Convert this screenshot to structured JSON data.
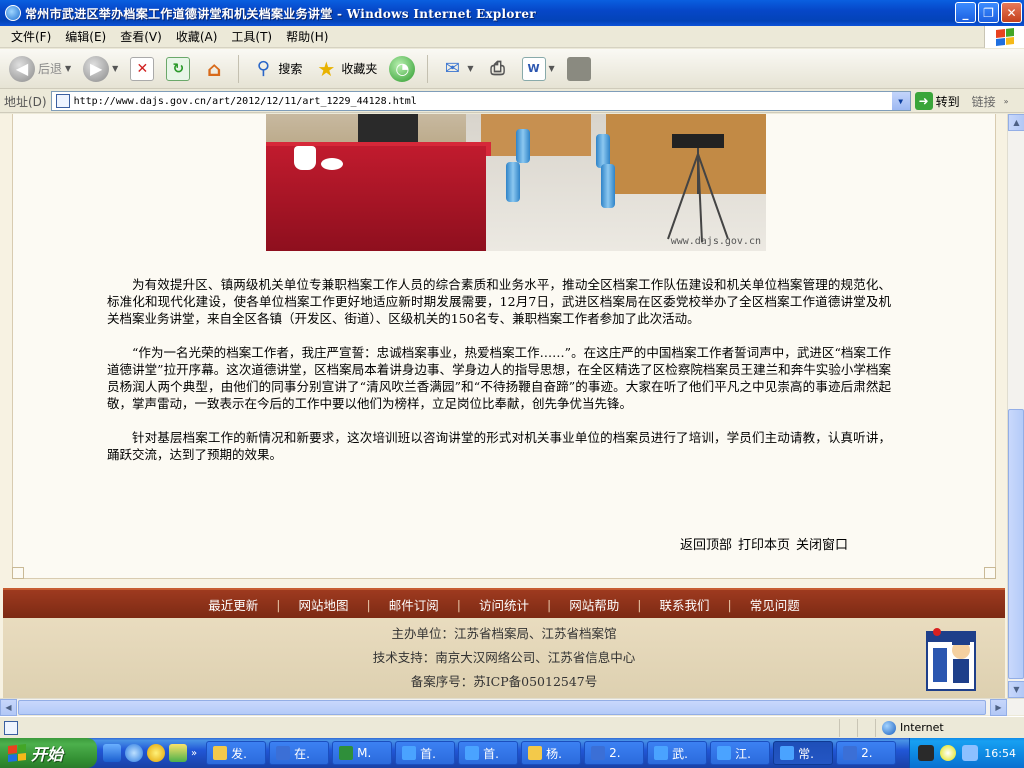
{
  "window": {
    "title": "常州市武进区举办档案工作道德讲堂和机关档案业务讲堂 - Windows Internet Explorer"
  },
  "menubar": {
    "items": [
      "文件(F)",
      "编辑(E)",
      "查看(V)",
      "收藏(A)",
      "工具(T)",
      "帮助(H)"
    ]
  },
  "toolbar": {
    "back_label": "后退",
    "search_label": "搜索",
    "favorites_label": "收藏夹"
  },
  "address": {
    "label": "地址(D)",
    "url": "http://www.dajs.gov.cn/art/2012/12/11/art_1229_44128.html",
    "go_label": "转到",
    "links_label": "链接"
  },
  "photo": {
    "watermark": "www.dajs.gov.cn"
  },
  "article": {
    "paragraphs": [
      "为有效提升区、镇两级机关单位专兼职档案工作人员的综合素质和业务水平，推动全区档案工作队伍建设和机关单位档案管理的规范化、标准化和现代化建设，使各单位档案工作更好地适应新时期发展需要，12月7日，武进区档案局在区委党校举办了全区档案工作道德讲堂及机关档案业务讲堂，来自全区各镇（开发区、街道）、区级机关的150名专、兼职档案工作者参加了此次活动。",
      "“作为一名光荣的档案工作者，我庄严宣誓：忠诚档案事业，热爱档案工作……”。在这庄严的中国档案工作者誓词声中，武进区“档案工作道德讲堂”拉开序幕。这次道德讲堂，区档案局本着讲身边事、学身边人的指导思想，在全区精选了区检察院档案员王建兰和奔牛实验小学档案员杨润人两个典型，由他们的同事分别宣讲了“清风吹兰香满园”和“不待扬鞭自奋蹄”的事迹。大家在听了他们平凡之中见崇高的事迹后肃然起敬，掌声雷动，一致表示在今后的工作中要以他们为榜样，立足岗位比奉献，创先争优当先锋。",
      "针对基层档案工作的新情况和新要求，这次培训班以咨询讲堂的形式对机关事业单位的档案员进行了培训，学员们主动请教，认真听讲，踊跃交流，达到了预期的效果。"
    ],
    "links": [
      "返回顶部",
      "打印本页",
      "关闭窗口"
    ]
  },
  "footer": {
    "nav": [
      "最近更新",
      "网站地图",
      "邮件订阅",
      "访问统计",
      "网站帮助",
      "联系我们",
      "常见问题"
    ],
    "separator": "|",
    "host": "主办单位：江苏省档案局、江苏省档案馆",
    "tech": "技术支持：南京大汉网络公司、江苏省信息中心",
    "icp": "备案序号：苏ICP备05012547号"
  },
  "status": {
    "zone": "Internet"
  },
  "taskbar": {
    "start_label": "开始",
    "tasks": [
      {
        "label": "发.",
        "icon": "folder-icon",
        "color": "#f3c94a"
      },
      {
        "label": "在.",
        "icon": "word-icon",
        "color": "#3b6fd6"
      },
      {
        "label": "M.",
        "icon": "excel-icon",
        "color": "#2f8f3a"
      },
      {
        "label": "首.",
        "icon": "ie-icon",
        "color": "#4aa3ff"
      },
      {
        "label": "首.",
        "icon": "ie-icon",
        "color": "#4aa3ff"
      },
      {
        "label": "杨.",
        "icon": "folder-icon",
        "color": "#f3c94a"
      },
      {
        "label": "2.",
        "icon": "word-icon",
        "color": "#3b6fd6"
      },
      {
        "label": "武.",
        "icon": "ie-icon",
        "color": "#4aa3ff"
      },
      {
        "label": "江.",
        "icon": "ie-icon",
        "color": "#4aa3ff"
      },
      {
        "label": "常.",
        "icon": "ie-icon",
        "color": "#4aa3ff"
      },
      {
        "label": "2.",
        "icon": "word-icon",
        "color": "#3b6fd6"
      }
    ],
    "active_task_index": 9,
    "clock": "16:54"
  },
  "colors": {
    "titlebar": "#0a5fe0",
    "footer_nav": "#8e3218",
    "footer_bg": "#e4d7b8",
    "start": "#3c9a3c"
  }
}
